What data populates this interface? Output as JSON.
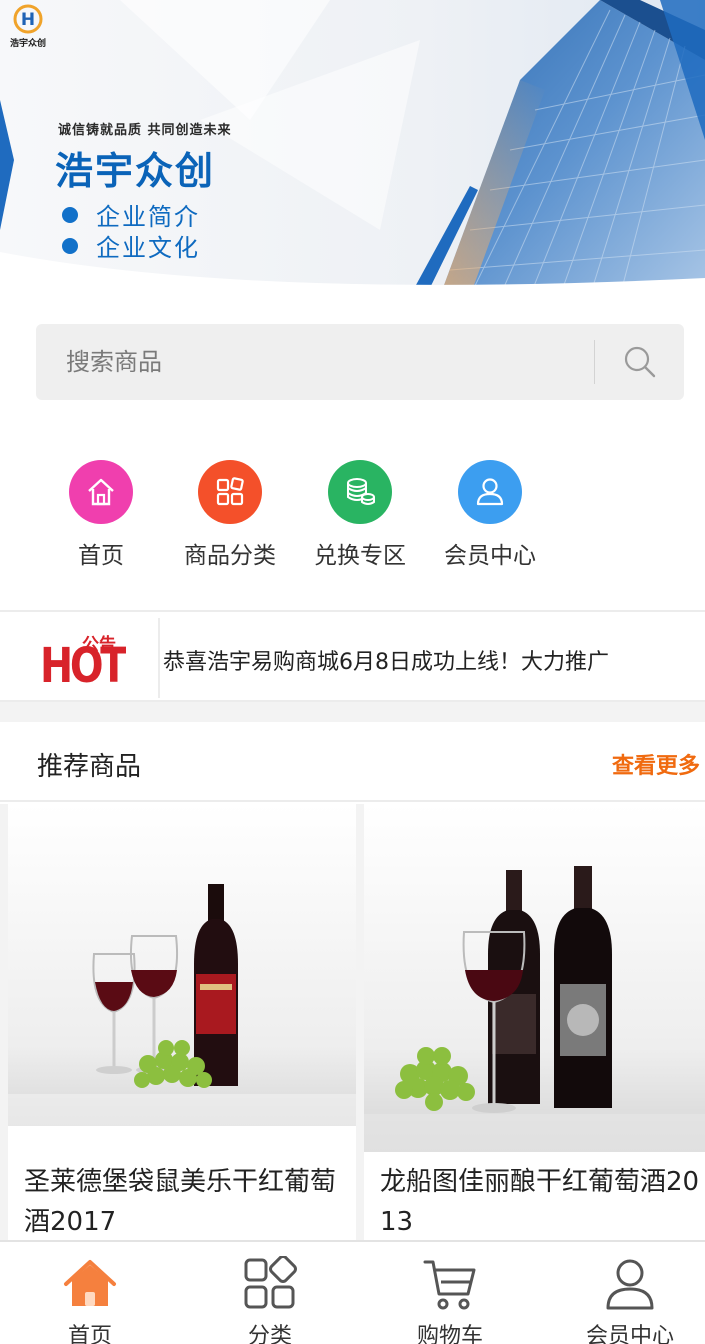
{
  "banner": {
    "logo_text": "浩宇众创",
    "slogan": "诚信铸就品质 共同创造未来",
    "brand": "浩宇众创",
    "links": [
      "企业简介",
      "企业文化"
    ]
  },
  "search": {
    "placeholder": "搜索商品",
    "icon": "search-icon"
  },
  "quicknav": [
    {
      "label": "首页",
      "icon": "home-icon",
      "color": "#f03fae"
    },
    {
      "label": "商品分类",
      "icon": "grid-icon",
      "color": "#f4502a"
    },
    {
      "label": "兑换专区",
      "icon": "coins-icon",
      "color": "#29b462"
    },
    {
      "label": "会员中心",
      "icon": "user-icon",
      "color": "#3c9ef0"
    }
  ],
  "notice": {
    "badge_top": "公告",
    "badge_main": "HOT",
    "text": "恭喜浩宇易购商城6月8日成功上线！大力推广"
  },
  "recommend": {
    "title": "推荐商品",
    "more": "查看更多",
    "products": [
      {
        "name": "圣莱德堡袋鼠美乐干红葡萄酒2017"
      },
      {
        "name": "龙船图佳丽酿干红葡萄酒2013"
      }
    ]
  },
  "tabbar": [
    {
      "label": "首页",
      "icon": "home-icon",
      "active": true
    },
    {
      "label": "分类",
      "icon": "category-icon",
      "active": false
    },
    {
      "label": "购物车",
      "icon": "cart-icon",
      "active": false
    },
    {
      "label": "会员中心",
      "icon": "user-icon",
      "active": false
    }
  ],
  "colors": {
    "accent": "#f06a0f",
    "brand_blue": "#0a63b8",
    "tab_active": "#f5803e"
  }
}
